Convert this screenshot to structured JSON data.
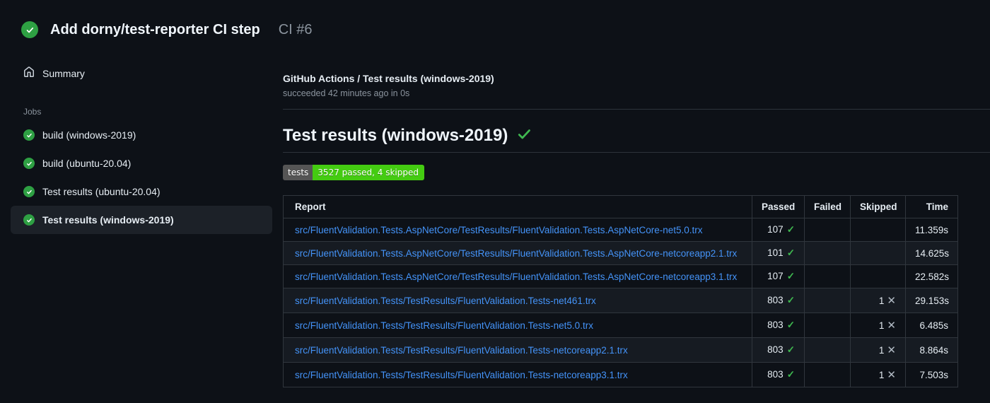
{
  "header": {
    "title": "Add dorny/test-reporter CI step",
    "run_number": "CI #6"
  },
  "sidebar": {
    "summary_label": "Summary",
    "jobs_label": "Jobs",
    "jobs": [
      {
        "label": "build (windows-2019)",
        "selected": false
      },
      {
        "label": "build (ubuntu-20.04)",
        "selected": false
      },
      {
        "label": "Test results (ubuntu-20.04)",
        "selected": false
      },
      {
        "label": "Test results (windows-2019)",
        "selected": true
      }
    ]
  },
  "main": {
    "breadcrumb": "GitHub Actions / Test results (windows-2019)",
    "status_line": "succeeded 42 minutes ago in 0s",
    "section_title": "Test results (windows-2019)",
    "badge": {
      "label": "tests",
      "value": "3527 passed, 4 skipped"
    },
    "table": {
      "columns": [
        "Report",
        "Passed",
        "Failed",
        "Skipped",
        "Time"
      ],
      "rows": [
        {
          "report": "src/FluentValidation.Tests.AspNetCore/TestResults/FluentValidation.Tests.AspNetCore-net5.0.trx",
          "passed": "107",
          "failed": "",
          "skipped": "",
          "time": "11.359s"
        },
        {
          "report": "src/FluentValidation.Tests.AspNetCore/TestResults/FluentValidation.Tests.AspNetCore-netcoreapp2.1.trx",
          "passed": "101",
          "failed": "",
          "skipped": "",
          "time": "14.625s"
        },
        {
          "report": "src/FluentValidation.Tests.AspNetCore/TestResults/FluentValidation.Tests.AspNetCore-netcoreapp3.1.trx",
          "passed": "107",
          "failed": "",
          "skipped": "",
          "time": "22.582s"
        },
        {
          "report": "src/FluentValidation.Tests/TestResults/FluentValidation.Tests-net461.trx",
          "passed": "803",
          "failed": "",
          "skipped": "1",
          "time": "29.153s"
        },
        {
          "report": "src/FluentValidation.Tests/TestResults/FluentValidation.Tests-net5.0.trx",
          "passed": "803",
          "failed": "",
          "skipped": "1",
          "time": "6.485s"
        },
        {
          "report": "src/FluentValidation.Tests/TestResults/FluentValidation.Tests-netcoreapp2.1.trx",
          "passed": "803",
          "failed": "",
          "skipped": "1",
          "time": "8.864s"
        },
        {
          "report": "src/FluentValidation.Tests/TestResults/FluentValidation.Tests-netcoreapp3.1.trx",
          "passed": "803",
          "failed": "",
          "skipped": "1",
          "time": "7.503s"
        }
      ]
    }
  },
  "icons": {
    "header_status": "check-circle-icon",
    "sidebar_summary": "home-icon",
    "job_status": "check-circle-icon",
    "section_status": "check-icon",
    "passed_cell": "check-icon",
    "skipped_cell": "x-icon"
  },
  "colors": {
    "background": "#0d1117",
    "row_alt": "#161b22",
    "border": "#30363d",
    "selected_item": "#1c2128",
    "text_primary": "#e6edf3",
    "text_secondary": "#8b949e",
    "link": "#4493f8",
    "success_green": "#3fb950",
    "icon_circle_green": "#2ea043",
    "badge_gray": "#555555",
    "badge_green": "#44cc11"
  }
}
